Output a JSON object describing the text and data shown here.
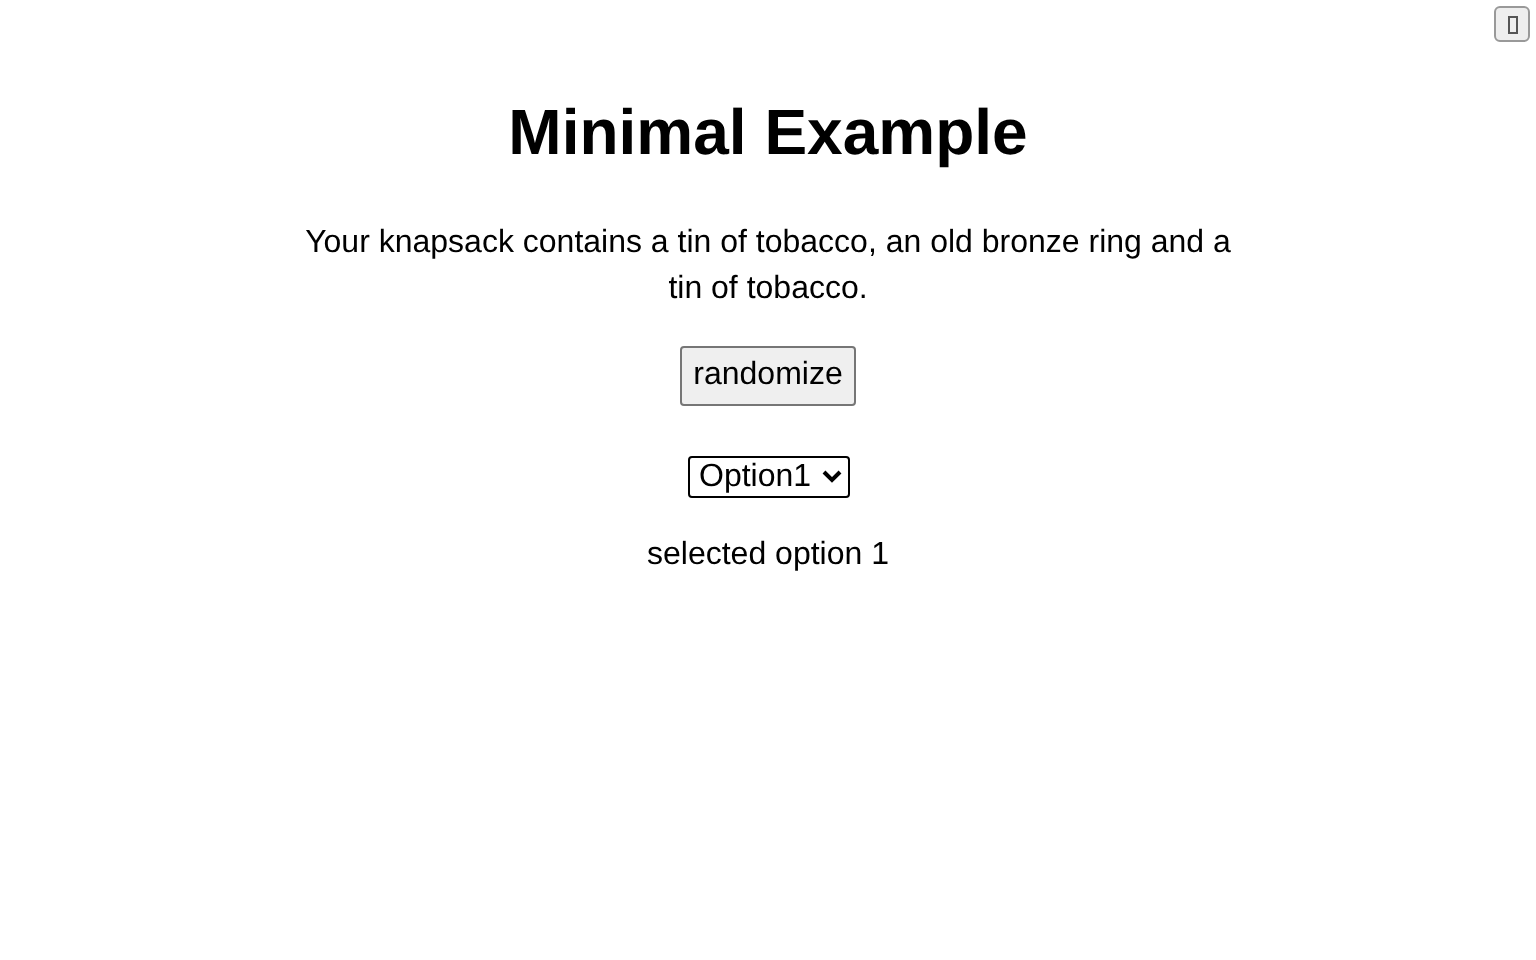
{
  "title": "Minimal Example",
  "description": "Your knapsack contains a tin of tobacco, an old bronze ring and a tin of tobacco.",
  "button": "randomize",
  "select": {
    "value": "Option1"
  },
  "result": "selected option 1"
}
